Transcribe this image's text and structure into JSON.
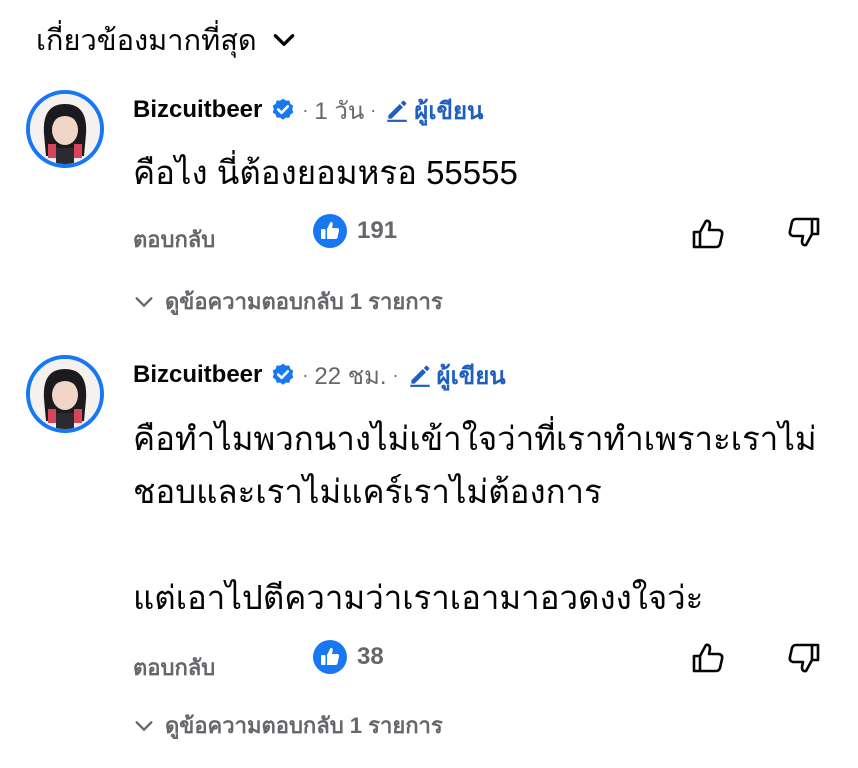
{
  "sort": {
    "label": "เกี่ยวข้องมากที่สุด"
  },
  "comments": [
    {
      "name": "Bizcuitbeer",
      "time": "1 วัน",
      "author_label": "ผู้เขียน",
      "text": "คือไง นี่ต้องยอมหรอ 55555",
      "reply_label": "ตอบกลับ",
      "like_count": "191",
      "view_replies_label": "ดูข้อความตอบกลับ 1 รายการ"
    },
    {
      "name": "Bizcuitbeer",
      "time": "22 ชม.",
      "author_label": "ผู้เขียน",
      "text": "คือทำไมพวกนางไม่เข้าใจว่าที่เราทำเพราะเราไม่\nชอบและเราไม่แคร์เราไม่ต้องการ\n\nแต่เอาไปตีความว่าเราเอามาอวดงงใจว่ะ",
      "reply_label": "ตอบกลับ",
      "like_count": "38",
      "view_replies_label": "ดูข้อความตอบกลับ 1 รายการ"
    }
  ],
  "colors": {
    "accent": "#1877f2",
    "author": "#1f5fbf",
    "muted": "#65676b"
  },
  "icons": [
    "chevron-down-icon",
    "verified-badge-icon",
    "pencil-icon",
    "like-reaction-icon",
    "thumbs-up-icon",
    "thumbs-down-icon"
  ]
}
